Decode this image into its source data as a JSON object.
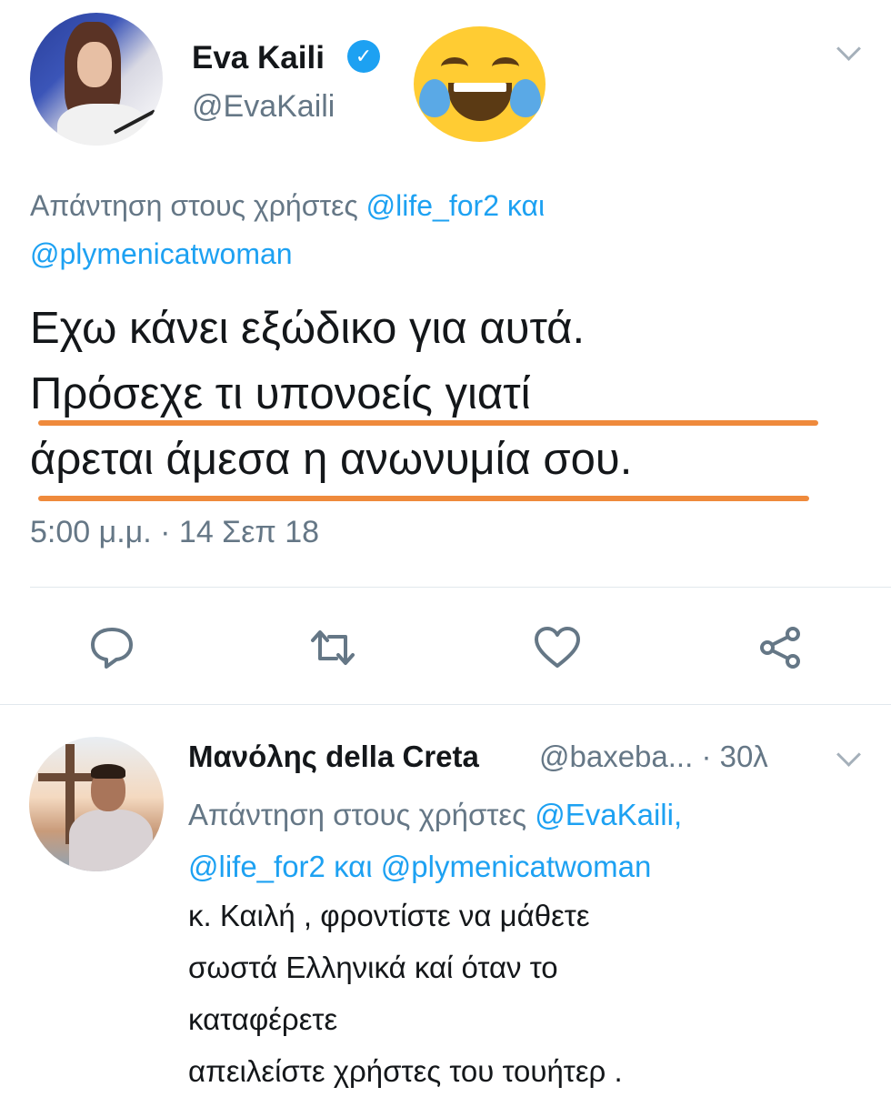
{
  "main_tweet": {
    "author_name": "Eva Kaili",
    "verified": true,
    "handle": "@EvaKaili",
    "reply_prefix": "Απάντηση στους χρήστες",
    "reply_mention_1": "@life_for2",
    "reply_joiner": "και",
    "reply_mention_2": "@plymenicatwoman",
    "text_lines": [
      "Εχω κάνει εξώδικο για αυτά.",
      "Πρόσεχε τι υπονοείς γιατί",
      "άρεται άμεσα η ανωνυμία σου."
    ],
    "timestamp": "5:00 μ.μ. · 14 Σεπ 18",
    "highlight_color": "#ef8a3c",
    "actions": [
      "reply-icon",
      "retweet-icon",
      "like-icon",
      "share-icon"
    ]
  },
  "reply_tweet": {
    "author_name": "Μανόλης della Creta",
    "handle_and_time": "@baxeba... · 30λ",
    "reply_prefix": "Απάντηση στους χρήστες",
    "reply_mention_1": "@EvaKaili,",
    "reply_mention_2": "@life_for2",
    "reply_joiner": "και",
    "reply_mention_3": "@plymenicatwoman",
    "text_lines": [
      "κ. Καιλή , φροντίστε να μάθετε",
      "σωστά Ελληνικά καί όταν το",
      "καταφέρετε",
      "απειλείστε χρήστες του τουήτερ ."
    ]
  },
  "colors": {
    "link_blue": "#1da1f2",
    "secondary_gray": "#657786",
    "text_dark": "#14171a"
  }
}
